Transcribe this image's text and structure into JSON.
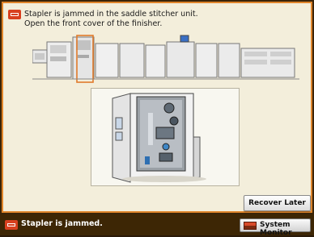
{
  "alert": {
    "line1": "Stapler is jammed in the saddle stitcher unit.",
    "line2": "Open the front cover of the finisher.",
    "icon": "error-badge-icon"
  },
  "illustrations": {
    "printer_overview": "printer-system-icon",
    "finisher_detail": "finisher-front-cover-open-illustration"
  },
  "buttons": {
    "recover_later": "Recover Later",
    "system_monitor": "System Monitor"
  },
  "status_bar": {
    "message": "Stapler is jammed.",
    "icon": "error-badge-icon"
  },
  "colors": {
    "accent": "#e0852a",
    "error": "#d8401f",
    "highlight_box": "#e07a2a"
  }
}
